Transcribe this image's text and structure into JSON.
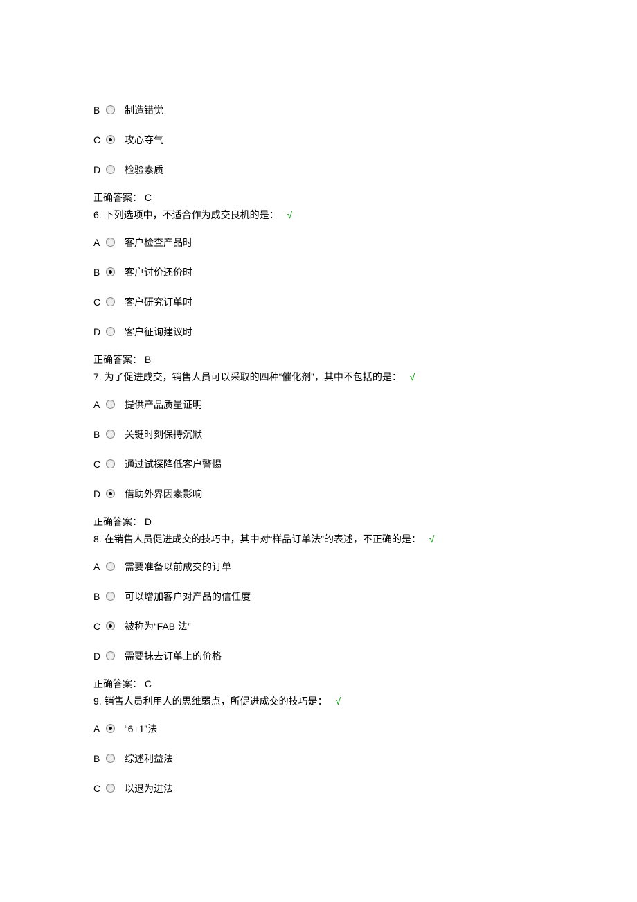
{
  "partial_q5": {
    "options": [
      {
        "letter": "B",
        "checked": false,
        "text": "制造错觉"
      },
      {
        "letter": "C",
        "checked": true,
        "text": "攻心夺气"
      },
      {
        "letter": "D",
        "checked": false,
        "text": "检验素质"
      }
    ],
    "answer_label": "正确答案：",
    "answer_value": "C"
  },
  "q6": {
    "number": "6.",
    "text": "下列选项中，不适合作为成交良机的是：",
    "mark": "√",
    "options": [
      {
        "letter": "A",
        "checked": false,
        "text": "客户检查产品时"
      },
      {
        "letter": "B",
        "checked": true,
        "text": "客户讨价还价时"
      },
      {
        "letter": "C",
        "checked": false,
        "text": "客户研究订单时"
      },
      {
        "letter": "D",
        "checked": false,
        "text": "客户征询建议时"
      }
    ],
    "answer_label": "正确答案：",
    "answer_value": "B"
  },
  "q7": {
    "number": "7.",
    "text": "为了促进成交，销售人员可以采取的四种“催化剂”，其中不包括的是：",
    "mark": "√",
    "options": [
      {
        "letter": "A",
        "checked": false,
        "text": "提供产品质量证明"
      },
      {
        "letter": "B",
        "checked": false,
        "text": "关键时刻保持沉默"
      },
      {
        "letter": "C",
        "checked": false,
        "text": "通过试探降低客户警惕"
      },
      {
        "letter": "D",
        "checked": true,
        "text": "借助外界因素影响"
      }
    ],
    "answer_label": "正确答案：",
    "answer_value": "D"
  },
  "q8": {
    "number": "8.",
    "text": "在销售人员促进成交的技巧中，其中对“样品订单法”的表述，不正确的是：",
    "mark": "√",
    "options": [
      {
        "letter": "A",
        "checked": false,
        "text": "需要准备以前成交的订单"
      },
      {
        "letter": "B",
        "checked": false,
        "text": "可以增加客户对产品的信任度"
      },
      {
        "letter": "C",
        "checked": true,
        "text": "被称为“FAB 法”"
      },
      {
        "letter": "D",
        "checked": false,
        "text": "需要抹去订单上的价格"
      }
    ],
    "answer_label": "正确答案：",
    "answer_value": "C"
  },
  "q9": {
    "number": "9.",
    "text": "销售人员利用人的思维弱点，所促进成交的技巧是：",
    "mark": "√",
    "options": [
      {
        "letter": "A",
        "checked": true,
        "text": "“6+1”法"
      },
      {
        "letter": "B",
        "checked": false,
        "text": "综述利益法"
      },
      {
        "letter": "C",
        "checked": false,
        "text": "以退为进法"
      }
    ]
  }
}
